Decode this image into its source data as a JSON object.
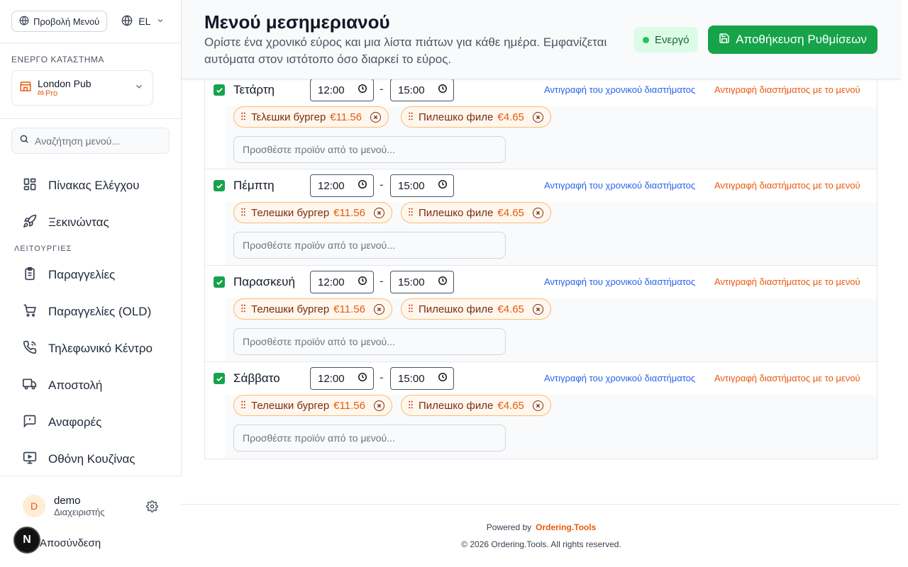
{
  "sidebar": {
    "view_menu_label": "Προβολή Μενού",
    "language": "EL",
    "active_store_label": "ΕΝΕΡΓΟ ΚΑΤΑΣΤΗΜΑ",
    "store_name": "London Pub",
    "store_plan": "Pro",
    "search_placeholder": "Αναζήτηση μενού...",
    "nav_top": [
      {
        "label": "Πίνακας Ελέγχου",
        "icon": "dashboard-icon"
      },
      {
        "label": "Ξεκινώντας",
        "icon": "rocket-icon"
      }
    ],
    "section_label": "ΛΕΙΤΟΥΡΓΙΕΣ",
    "nav_ops": [
      {
        "label": "Παραγγελίες",
        "icon": "clipboard-icon"
      },
      {
        "label": "Παραγγελίες (OLD)",
        "icon": "cart-icon"
      },
      {
        "label": "Τηλεφωνικό Κέντρο",
        "icon": "phone-icon"
      },
      {
        "label": "Αποστολή",
        "icon": "truck-icon"
      },
      {
        "label": "Αναφορές",
        "icon": "report-icon"
      },
      {
        "label": "Οθόνη Κουζίνας",
        "icon": "monitor-icon"
      }
    ],
    "user": {
      "initial": "D",
      "name": "demo",
      "role": "Διαχειριστής"
    },
    "logout_label": "Αποσύνδεση",
    "corner_badge": "N"
  },
  "header": {
    "title": "Μενού μεσημεριανού",
    "description": "Ορίστε ένα χρονικό εύρος και μια λίστα πιάτων για κάθε ημέρα. Εμφανίζεται αυτόματα στον ιστότοπο όσο διαρκεί το εύρος.",
    "status": "Ενεργό",
    "save_label": "Αποθήκευση Ρυθμίσεων"
  },
  "days": [
    {
      "name": "Τετάρτη",
      "enabled": true,
      "from": "12:00",
      "to": "15:00",
      "items": [
        {
          "name": "Τελεшки бургер",
          "price": "€11.56"
        },
        {
          "name": "Пилешко филе",
          "price": "€4.65"
        }
      ]
    },
    {
      "name": "Πέμπτη",
      "enabled": true,
      "from": "12:00",
      "to": "15:00",
      "items": [
        {
          "name": "Телешки бургер",
          "price": "€11.56"
        },
        {
          "name": "Пилешко филе",
          "price": "€4.65"
        }
      ]
    },
    {
      "name": "Παρασκευή",
      "enabled": true,
      "from": "12:00",
      "to": "15:00",
      "items": [
        {
          "name": "Телешки бургер",
          "price": "€11.56"
        },
        {
          "name": "Пилешко филе",
          "price": "€4.65"
        }
      ]
    },
    {
      "name": "Σάββατο",
      "enabled": true,
      "from": "12:00",
      "to": "15:00",
      "items": [
        {
          "name": "Телешки бургер",
          "price": "€11.56"
        },
        {
          "name": "Пилешко филе",
          "price": "€4.65"
        }
      ]
    }
  ],
  "day_labels": {
    "time_separator": "-",
    "copy_time": "Αντιγραφή του χρονικού διαστήματος",
    "copy_with_menu": "Αντιγραφή διαστήματος με το μενού",
    "add_placeholder": "Προσθέστε προϊόν από το μενού..."
  },
  "footer": {
    "powered_by": "Powered by",
    "brand": "Ordering.Tools",
    "copyright": "© 2026 Ordering.Tools. All rights reserved."
  },
  "colors": {
    "accent": "#16a34a",
    "brand": "#ea580c",
    "link": "#2563eb"
  }
}
